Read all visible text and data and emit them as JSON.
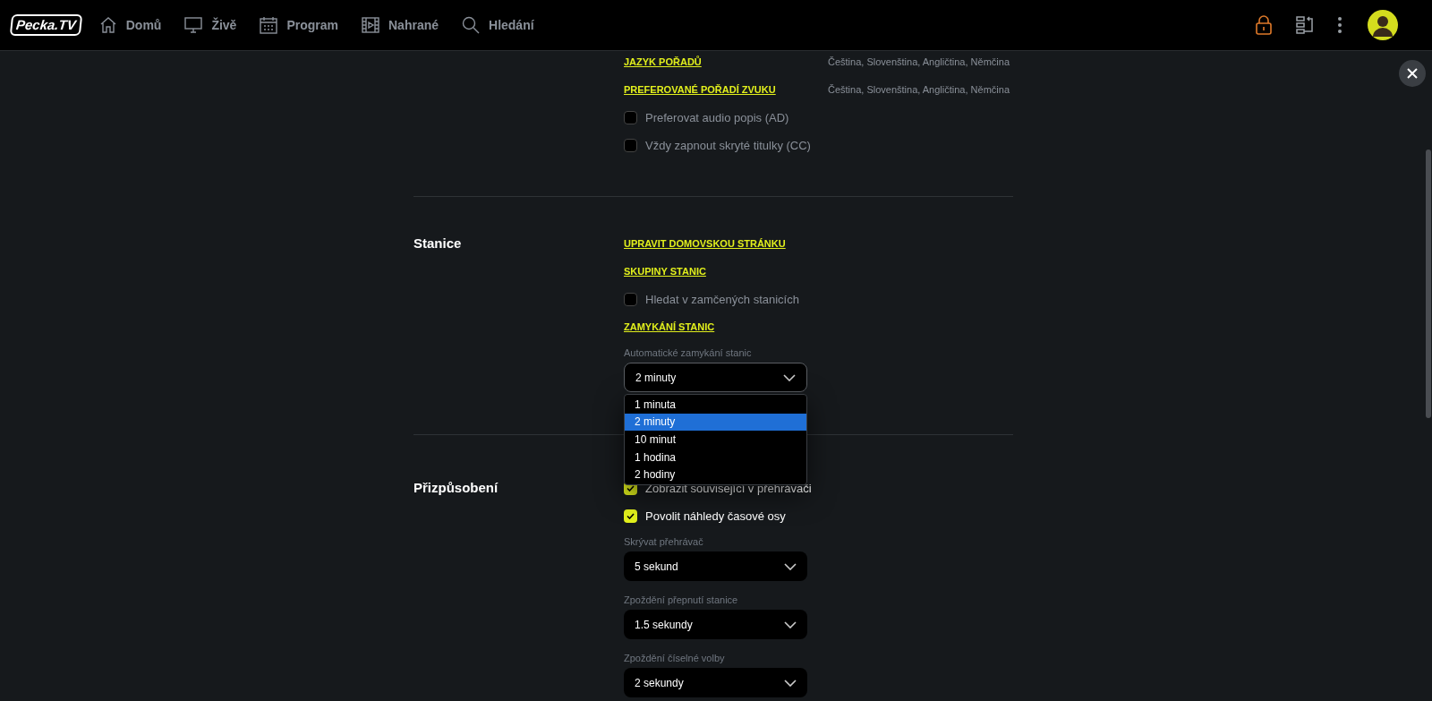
{
  "header": {
    "logo": "Pecka.TV",
    "nav": [
      {
        "label": "Domů"
      },
      {
        "label": "Živě"
      },
      {
        "label": "Program"
      },
      {
        "label": "Nahrané"
      },
      {
        "label": "Hledání"
      }
    ]
  },
  "sections": [
    {
      "items": [
        {
          "kind": "link",
          "label": "JAZYK POŘADŮ",
          "value": "Čeština, Slovenština, Angličtina, Němčina"
        },
        {
          "kind": "link",
          "label": "PREFEROVANÉ POŘADÍ ZVUKU",
          "value": "Čeština, Slovenština, Angličtina, Němčina"
        },
        {
          "kind": "checkbox",
          "label": "Preferovat audio popis (AD)",
          "checked": false
        },
        {
          "kind": "checkbox",
          "label": "Vždy zapnout skryté titulky (CC)",
          "checked": false
        }
      ]
    },
    {
      "title": "Stanice",
      "items": [
        {
          "kind": "link",
          "label": "UPRAVIT DOMOVSKOU STRÁNKU"
        },
        {
          "kind": "link",
          "label": "SKUPINY STANIC"
        },
        {
          "kind": "checkbox",
          "label": "Hledat v zamčených stanicích",
          "checked": false
        },
        {
          "kind": "link",
          "label": "ZAMYKÁNÍ STANIC"
        },
        {
          "kind": "select",
          "label": "Automatické zamykání stanic",
          "value": "2 minuty",
          "expanded": true,
          "options": [
            {
              "label": "1 minuta",
              "selected": false
            },
            {
              "label": "2 minuty",
              "selected": true
            },
            {
              "label": "10 minut",
              "selected": false
            },
            {
              "label": "1 hodina",
              "selected": false
            },
            {
              "label": "2 hodiny",
              "selected": false
            }
          ]
        }
      ]
    },
    {
      "title": "Přizpůsobení",
      "items": [
        {
          "kind": "checkbox",
          "label": "Zobrazit související v přehrávači",
          "checked": true
        },
        {
          "kind": "checkbox",
          "label": "Povolit náhledy časové osy",
          "checked": true
        },
        {
          "kind": "select",
          "label": "Skrývat přehrávač",
          "value": "5 sekund",
          "expanded": false
        },
        {
          "kind": "select",
          "label": "Zpoždění přepnutí stanice",
          "value": "1.5 sekundy",
          "expanded": false
        },
        {
          "kind": "select",
          "label": "Zpoždění číselné volby",
          "value": "2 sekundy",
          "expanded": false
        }
      ]
    }
  ]
}
